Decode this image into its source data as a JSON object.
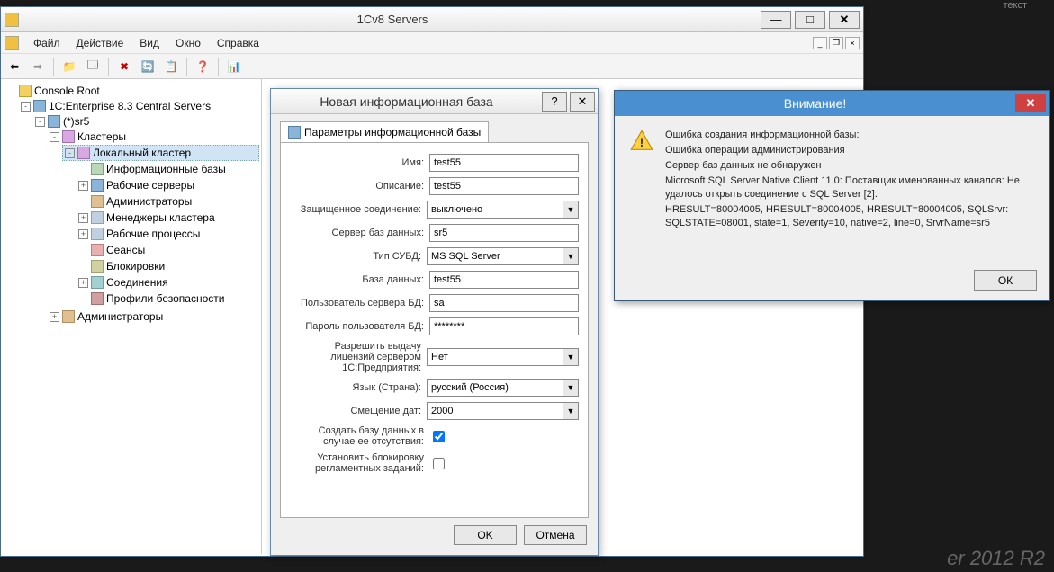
{
  "window": {
    "title": "1Cv8 Servers"
  },
  "menu": {
    "file": "Файл",
    "action": "Действие",
    "view": "Вид",
    "window": "Окно",
    "help": "Справка"
  },
  "tree": {
    "root": "Console Root",
    "central": "1C:Enterprise 8.3 Central Servers",
    "sr5": "(*)sr5",
    "clusters": "Кластеры",
    "local": "Локальный кластер",
    "infobases": "Информационные базы",
    "workservers": "Рабочие серверы",
    "admins": "Администраторы",
    "managers": "Менеджеры кластера",
    "procs": "Рабочие процессы",
    "sessions": "Сеансы",
    "locks": "Блокировки",
    "conns": "Соединения",
    "security": "Профили безопасности",
    "admins2": "Администраторы"
  },
  "dialog": {
    "title": "Новая информационная база",
    "tab": "Параметры информационной базы",
    "labels": {
      "name": "Имя:",
      "desc": "Описание:",
      "secure": "Защищенное соединение:",
      "dbserver": "Сервер баз данных:",
      "dbms": "Тип СУБД:",
      "db": "База данных:",
      "dbuser": "Пользователь сервера БД:",
      "dbpass": "Пароль пользователя БД:",
      "license": "Разрешить выдачу лицензий сервером 1С:Предприятия:",
      "lang": "Язык (Страна):",
      "dateoffset": "Смещение дат:",
      "createdb": "Создать базу данных в случае ее отсутствия:",
      "block": "Установить блокировку регламентных заданий:"
    },
    "values": {
      "name": "test55",
      "desc": "test55",
      "secure": "выключено",
      "dbserver": "sr5",
      "dbms": "MS SQL Server",
      "db": "test55",
      "dbuser": "sa",
      "dbpass": "********",
      "license": "Нет",
      "lang": "русский (Россия)",
      "dateoffset": "2000"
    },
    "ok": "OK",
    "cancel": "Отмена",
    "help": "?"
  },
  "alert": {
    "title": "Внимание!",
    "lines": [
      "Ошибка создания информационной базы:",
      "Ошибка операции администрирования",
      "Сервер баз данных не обнаружен",
      "Microsoft SQL Server Native Client 11.0: Поставщик именованных каналов: Не удалось открыть соединение с SQL Server [2].",
      "HRESULT=80004005, HRESULT=80004005, HRESULT=80004005, SQLSrvr: SQLSTATE=08001, state=1, Severity=10, native=2, line=0, SrvrName=sr5"
    ],
    "ok": "ОК"
  },
  "misc": {
    "topright": "текст",
    "bottomright": "er 2012 R2"
  }
}
